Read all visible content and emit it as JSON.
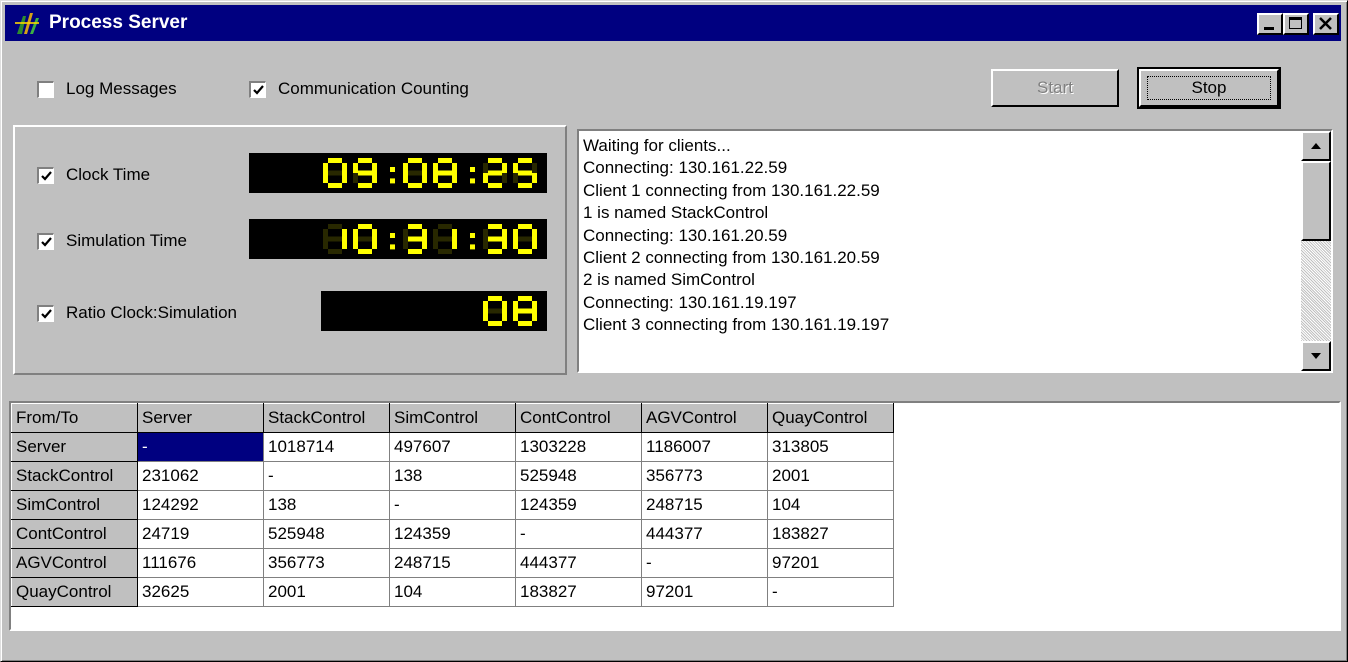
{
  "window": {
    "title": "Process Server",
    "icon": "process-server-app-icon",
    "controls": [
      "minimize-icon",
      "maximize-icon",
      "close-icon"
    ]
  },
  "options": {
    "log_messages": {
      "label": "Log Messages",
      "checked": false
    },
    "communication_counting": {
      "label": "Communication Counting",
      "checked": true
    }
  },
  "buttons": {
    "start": "Start",
    "stop": "Stop"
  },
  "clocks": {
    "clock_time": {
      "label": "Clock Time",
      "value": "09:08:25",
      "checked": true
    },
    "simulation_time": {
      "label": "Simulation Time",
      "value": "10:31:30",
      "checked": true
    },
    "ratio": {
      "label": "Ratio Clock:Simulation",
      "value": "08",
      "checked": true
    }
  },
  "lcd_colors": {
    "on": "#ffff00",
    "off": "#282800",
    "background": "#000000"
  },
  "log": {
    "lines": [
      "Waiting for clients...",
      "Connecting: 130.161.22.59",
      "Client 1 connecting from 130.161.22.59",
      "1 is named  StackControl",
      "Connecting: 130.161.20.59",
      "Client 2 connecting from 130.161.20.59",
      "2 is named  SimControl",
      "Connecting: 130.161.19.197",
      "Client 3 connecting from 130.161.19.197"
    ]
  },
  "matrix": {
    "corner": "From/To",
    "columns": [
      "Server",
      "StackControl",
      "SimControl",
      "ContControl",
      "AGVControl",
      "QuayControl"
    ],
    "rows": [
      {
        "label": "Server",
        "cells": [
          "-",
          "1018714",
          "497607",
          "1303228",
          "1186007",
          "313805"
        ]
      },
      {
        "label": "StackControl",
        "cells": [
          "231062",
          "-",
          "138",
          "525948",
          "356773",
          "2001"
        ]
      },
      {
        "label": "SimControl",
        "cells": [
          "124292",
          "138",
          "-",
          "124359",
          "248715",
          "104"
        ]
      },
      {
        "label": "ContControl",
        "cells": [
          "24719",
          "525948",
          "124359",
          "-",
          "444377",
          "183827"
        ]
      },
      {
        "label": "AGVControl",
        "cells": [
          "111676",
          "356773",
          "248715",
          "444377",
          "-",
          "97201"
        ]
      },
      {
        "label": "QuayControl",
        "cells": [
          "32625",
          "2001",
          "104",
          "183827",
          "97201",
          "-"
        ]
      }
    ]
  }
}
